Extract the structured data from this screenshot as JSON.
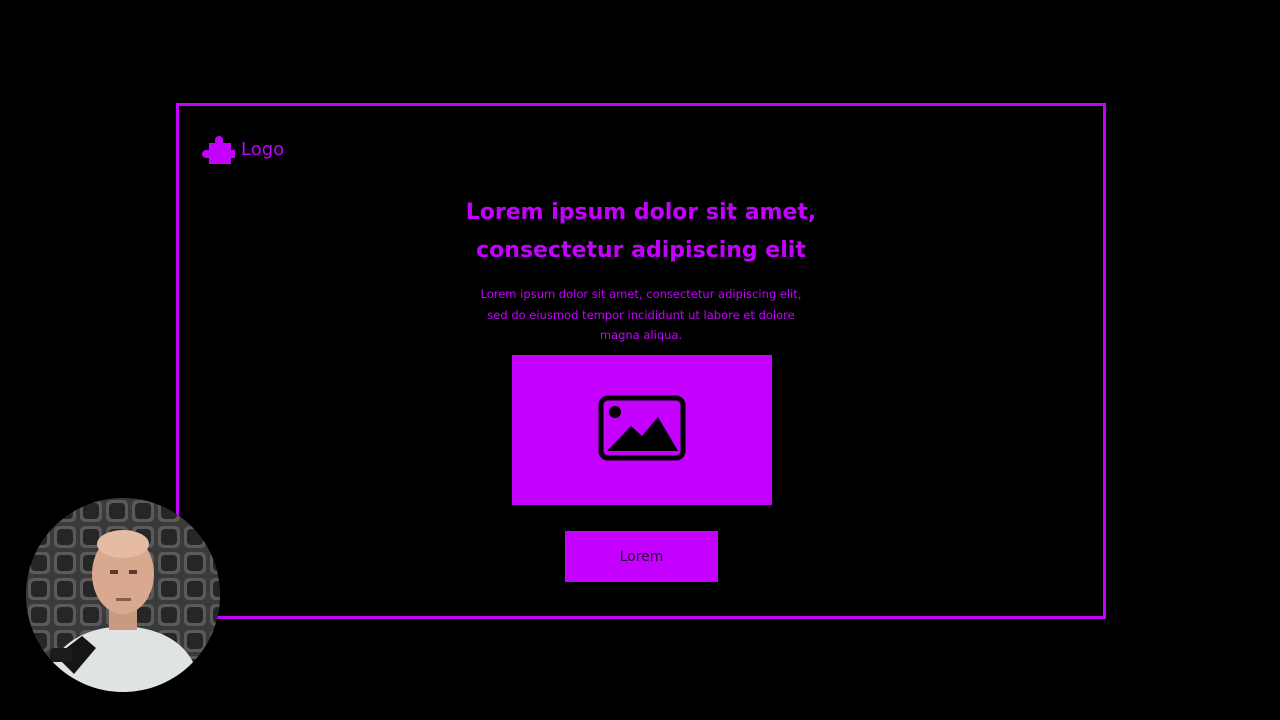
{
  "colors": {
    "accent": "#c400ff",
    "background": "#000000",
    "button_text": "#2a0033"
  },
  "logo": {
    "icon": "puzzle-icon",
    "text": "Logo"
  },
  "headline": {
    "line1": "Lorem ipsum dolor sit amet,",
    "line2": "consectetur adipiscing elit"
  },
  "subtext": {
    "line1": "Lorem ipsum dolor sit amet, consectetur adipiscing elit,",
    "line2": "sed do eiusmod tempor incididunt ut labore et dolore",
    "line3": "magna aliqua."
  },
  "image_placeholder": {
    "icon": "image-icon"
  },
  "cta": {
    "label": "Lorem"
  }
}
